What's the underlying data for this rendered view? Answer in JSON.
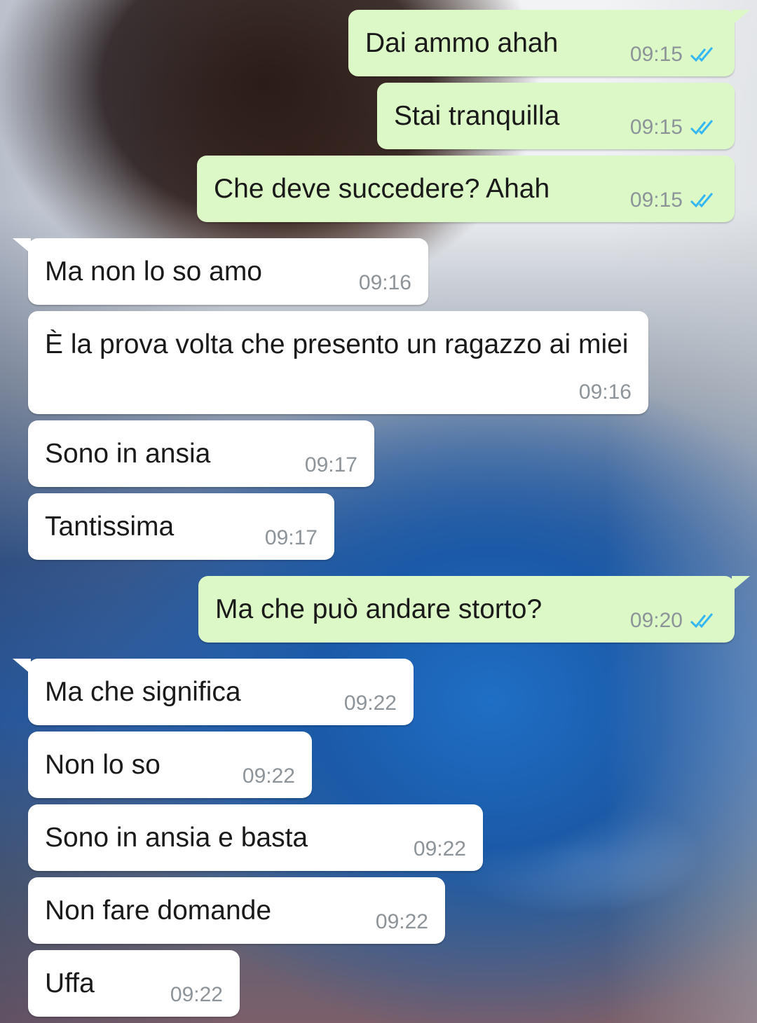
{
  "messages": [
    {
      "dir": "out",
      "text": "Dai ammo ahah",
      "time": "09:15",
      "status_icon": "double-check-read-icon"
    },
    {
      "dir": "out",
      "text": "Stai tranquilla",
      "time": "09:15",
      "status_icon": "double-check-read-icon"
    },
    {
      "dir": "out",
      "text": "Che deve succedere? Ahah",
      "time": "09:15",
      "status_icon": "double-check-read-icon"
    },
    {
      "dir": "in",
      "text": "Ma non lo so amo",
      "time": "09:16"
    },
    {
      "dir": "in",
      "text": "È la prova volta che presento un ragazzo ai miei",
      "time": "09:16"
    },
    {
      "dir": "in",
      "text": "Sono in ansia",
      "time": "09:17"
    },
    {
      "dir": "in",
      "text": "Tantissima",
      "time": "09:17"
    },
    {
      "dir": "out",
      "text": "Ma che può andare storto?",
      "time": "09:20",
      "status_icon": "double-check-read-icon"
    },
    {
      "dir": "in",
      "text": "Ma che significa",
      "time": "09:22"
    },
    {
      "dir": "in",
      "text": "Non lo so",
      "time": "09:22"
    },
    {
      "dir": "in",
      "text": "Sono in ansia e basta",
      "time": "09:22"
    },
    {
      "dir": "in",
      "text": "Non fare domande",
      "time": "09:22"
    },
    {
      "dir": "in",
      "text": "Uffa",
      "time": "09:22"
    }
  ],
  "colors": {
    "outgoing_bubble": "#dcf8c6",
    "incoming_bubble": "#ffffff",
    "timestamp": "#8d9499",
    "read_ticks": "#34b7f1"
  }
}
